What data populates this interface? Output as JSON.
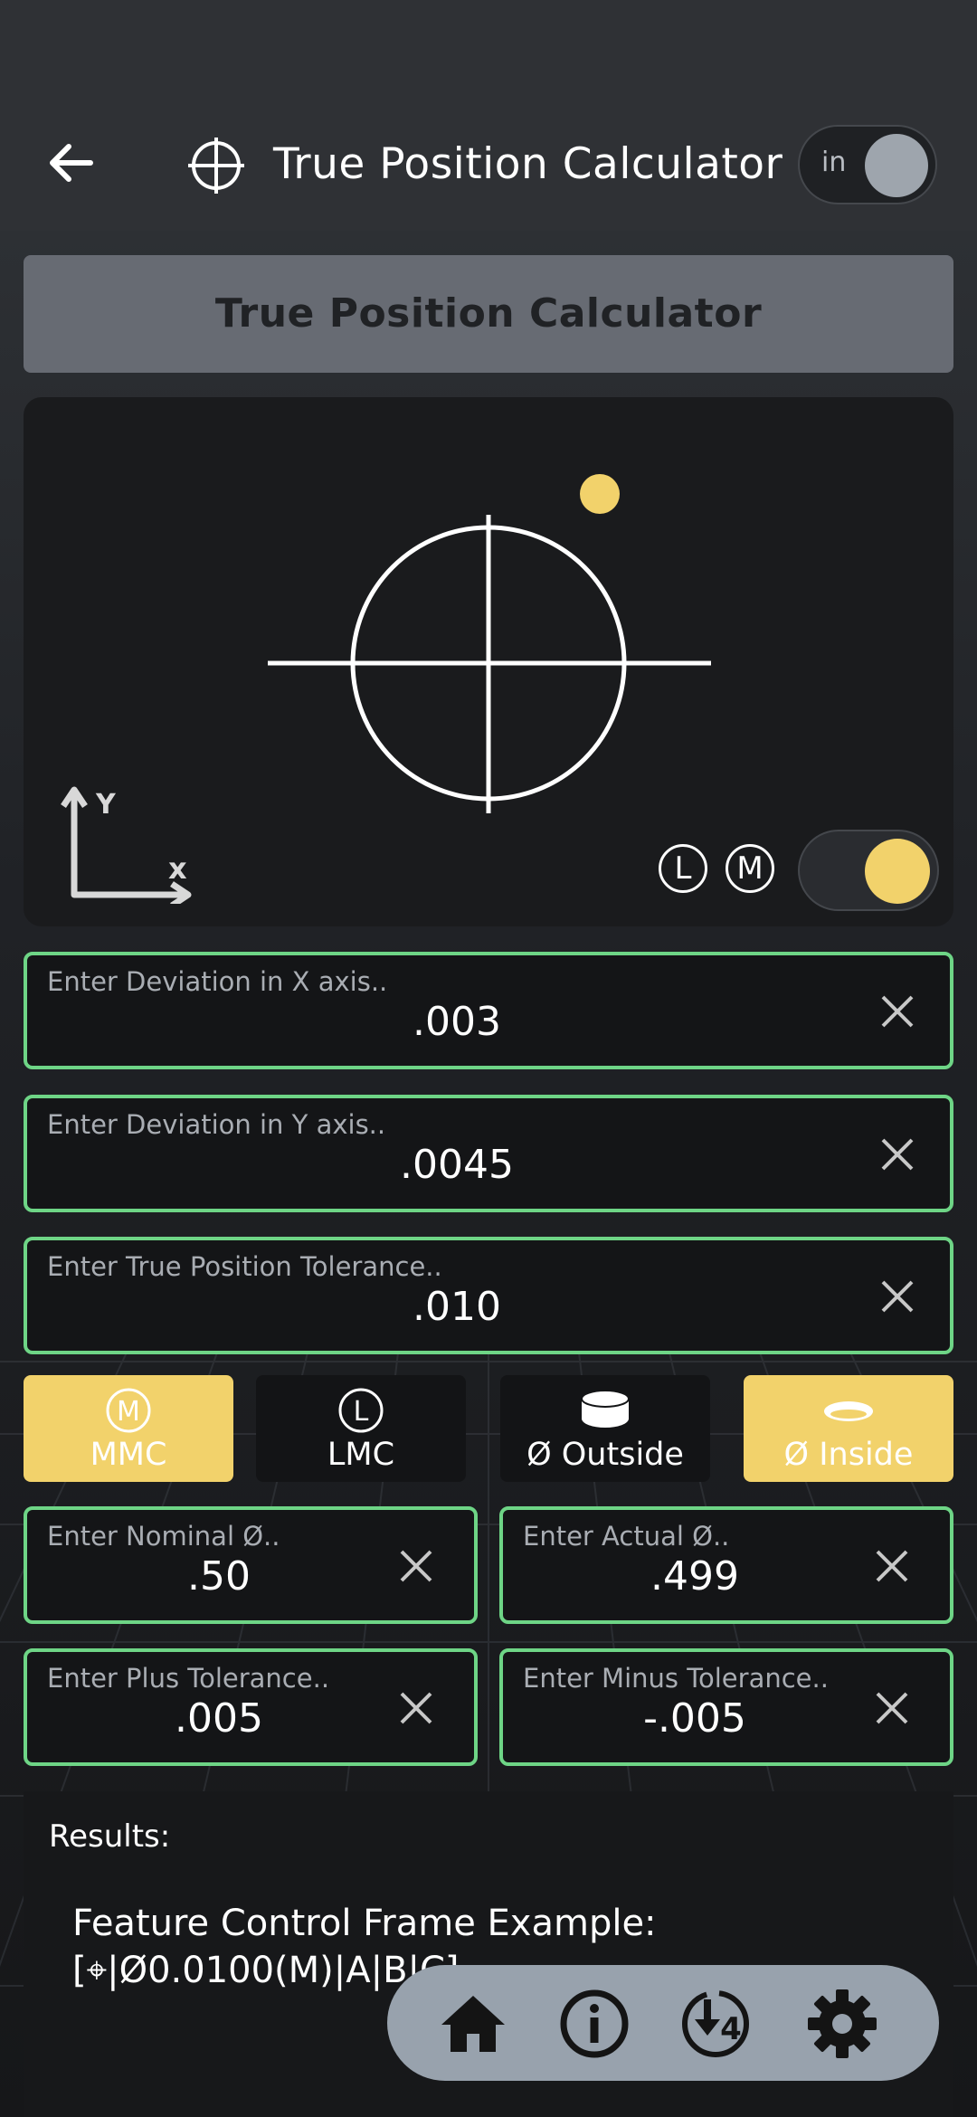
{
  "appbar": {
    "title": "True Position Calculator",
    "unit_label": "in"
  },
  "banner": {
    "title": "True Position Calculator"
  },
  "visualization": {
    "axis_y": "Y",
    "axis_x": "x",
    "lmc_badge": "L",
    "mmc_badge": "M",
    "marker_color": "#f2d26b"
  },
  "fields": {
    "dev_x": {
      "placeholder": "Enter Deviation in X axis..",
      "value": ".003"
    },
    "dev_y": {
      "placeholder": "Enter Deviation in Y axis..",
      "value": ".0045"
    },
    "tp_tol": {
      "placeholder": "Enter True Position Tolerance..",
      "value": ".010"
    },
    "nominal": {
      "placeholder": "Enter Nominal Ø..",
      "value": ".50"
    },
    "actual": {
      "placeholder": "Enter Actual Ø..",
      "value": ".499"
    },
    "plus_tol": {
      "placeholder": "Enter Plus Tolerance..",
      "value": ".005"
    },
    "minus_tol": {
      "placeholder": "Enter Minus Tolerance..",
      "value": "-.005"
    }
  },
  "options": {
    "mmc": {
      "label": "MMC",
      "icon_letter": "M",
      "selected": true
    },
    "lmc": {
      "label": "LMC",
      "icon_letter": "L",
      "selected": false
    },
    "outside": {
      "label": "Ø Outside",
      "selected": false
    },
    "inside": {
      "label": "Ø Inside",
      "selected": true
    }
  },
  "results": {
    "header": "Results:",
    "fcf_title": "Feature Control Frame Example:",
    "fcf_value": "[⌖|Ø0.0100(M)|A|B|C]"
  },
  "nav": {
    "badge_count": "4",
    "items": [
      "home-icon",
      "info-icon",
      "download-icon",
      "gear-icon"
    ]
  },
  "colors": {
    "accent_yellow": "#f2d26b",
    "field_border_green": "#6ed586",
    "nav_bg": "#98a2ad"
  }
}
